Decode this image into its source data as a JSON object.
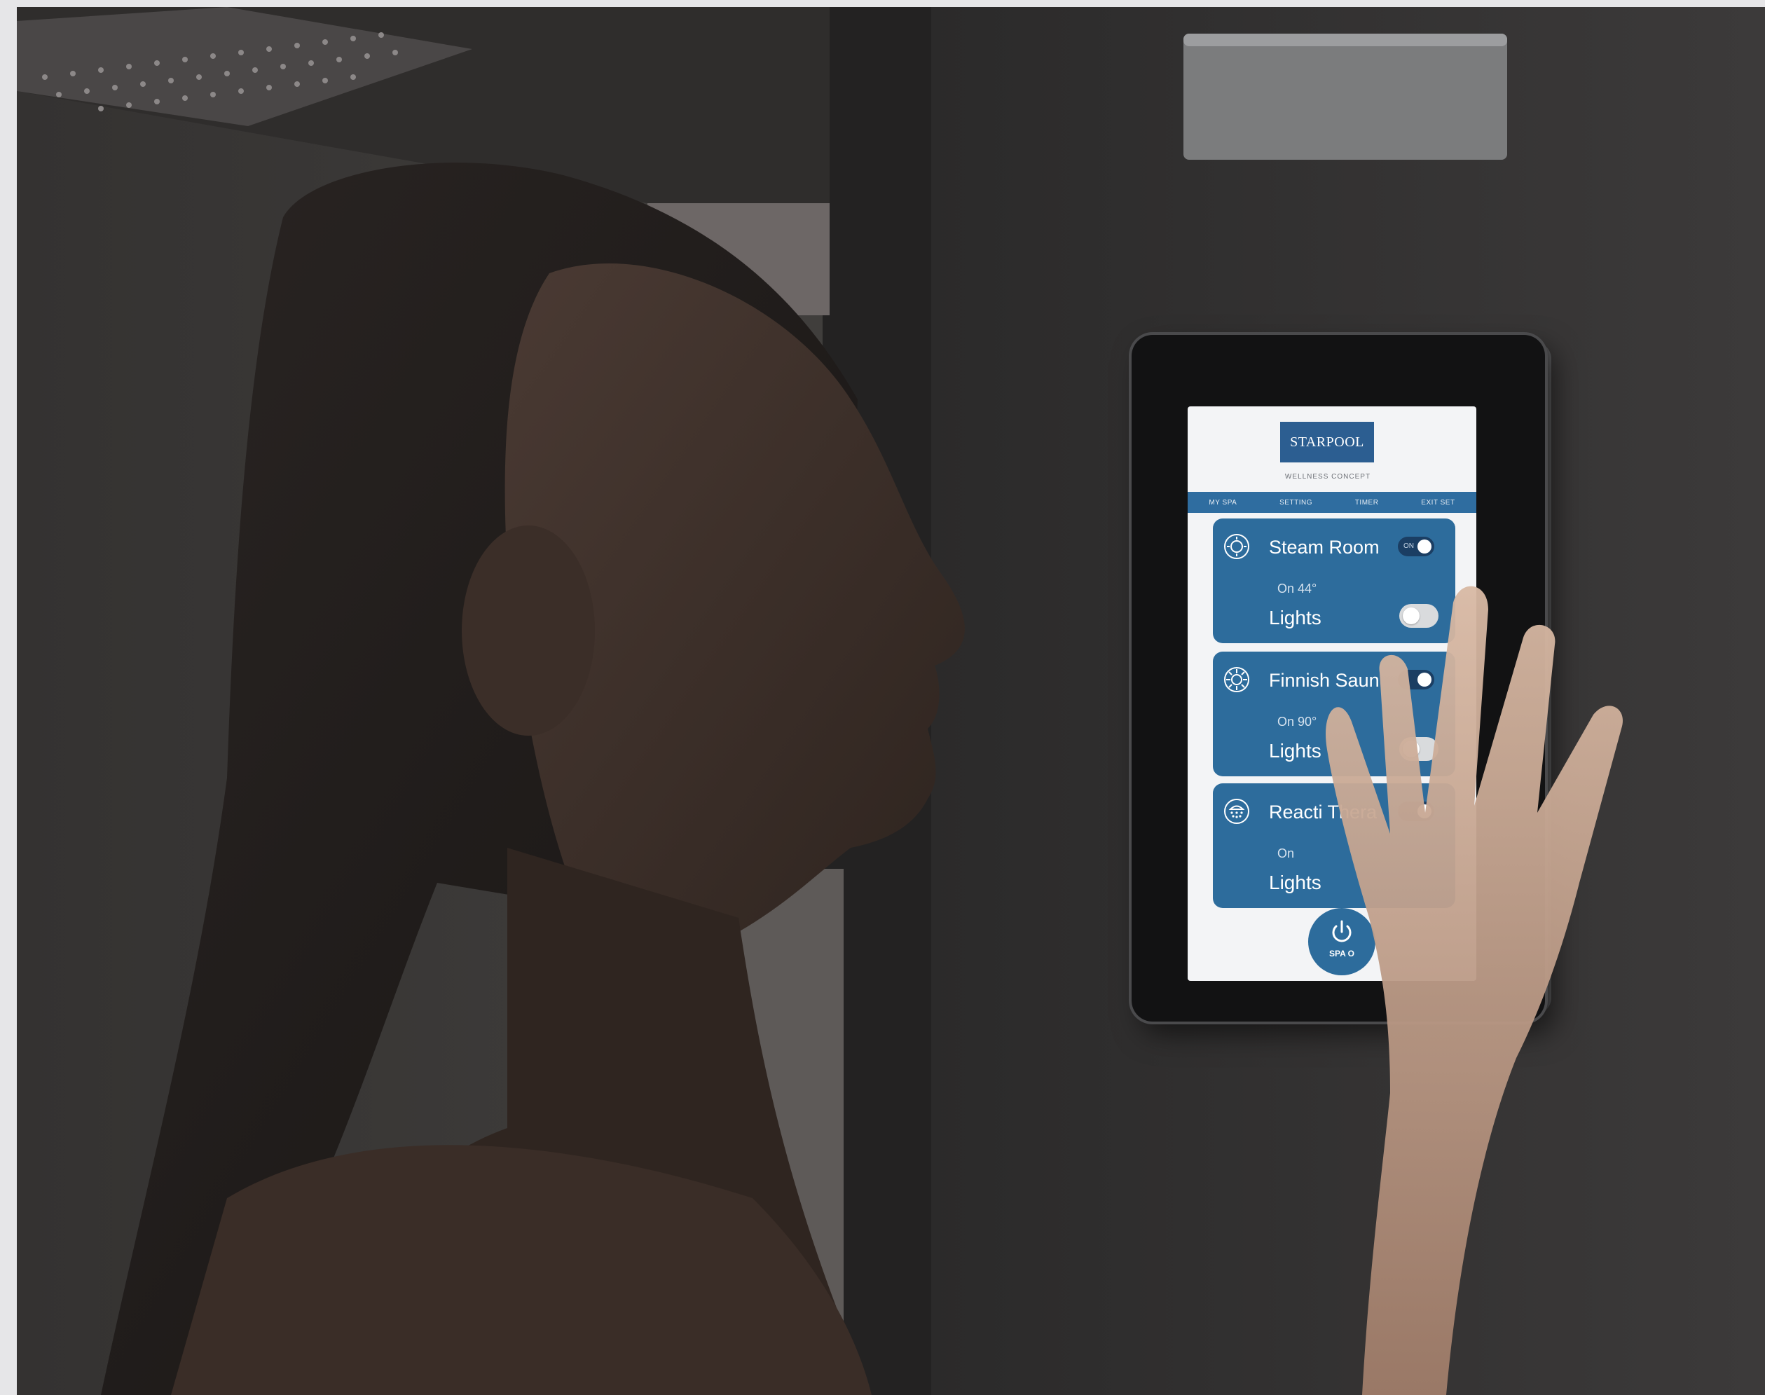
{
  "screen": {
    "brand": "STARPOOL",
    "tagline": "WELLNESS CONCEPT",
    "nav_tabs": [
      "MY SPA",
      "SETTING",
      "TIMER",
      "EXIT SET"
    ],
    "cards": [
      {
        "title": "Steam Room",
        "status": "On   44°",
        "lights": "Lights",
        "main_toggle_label": "ON",
        "main_toggle_on": true,
        "lights_toggle_on": false,
        "icon": "steam-room-icon"
      },
      {
        "title": "Finnish Saun",
        "status": "On   90°",
        "lights": "Lights",
        "main_toggle_on": true,
        "lights_toggle_on": false,
        "icon": "sauna-icon"
      },
      {
        "title": "Reacti  Thera",
        "status": "On",
        "lights": "Lights",
        "main_toggle_on": true,
        "lights_toggle_on": false,
        "icon": "shower-icon"
      }
    ],
    "spa_button_label": "SPA O",
    "spa_button_icon": "power-icon"
  },
  "colors": {
    "wall": "#3a3837",
    "screen_bg": "#f3f4f6",
    "card_blue": "#2d6c9c",
    "logo_blue": "#2c5e91",
    "nav_blue": "#2f6da0"
  }
}
